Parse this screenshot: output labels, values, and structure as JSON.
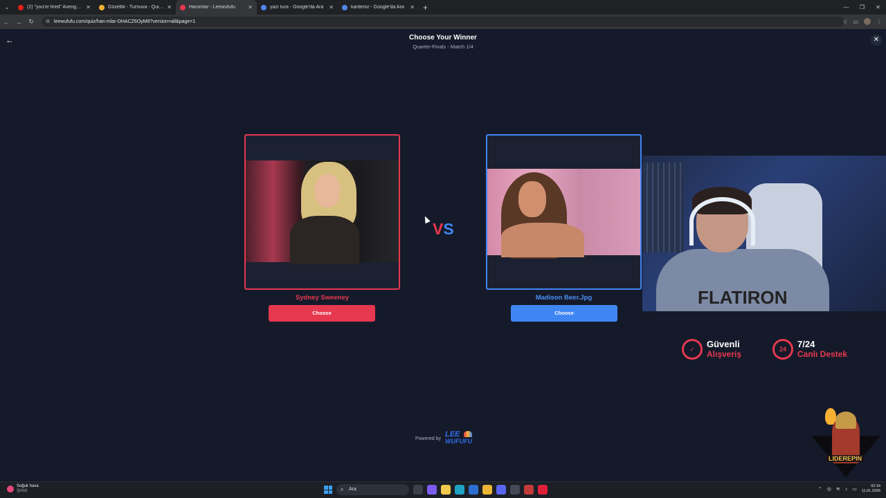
{
  "browser": {
    "tabs": [
      {
        "title": "(2) \"you're fired\" Avengers natu",
        "favicon_color": "#e62117",
        "active": false
      },
      {
        "title": "Güzellik - Turnuva - Quizei",
        "favicon_color": "#f2b134",
        "active": false
      },
      {
        "title": "Hanımlar - Leewufufu",
        "favicon_color": "#e6384f",
        "active": true
      },
      {
        "title": "yazı tura - Google'da Ara",
        "favicon_color": "#4f86ec",
        "active": false
      },
      {
        "title": "kardeniz - Google'da Ara",
        "favicon_color": "#4f86ec",
        "active": false
      }
    ],
    "url": "leewufufu.com/quiz/han-mlar-DHACZ6OyM8?version=all&page=1"
  },
  "page": {
    "title": "Choose Your Winner",
    "subtitle": "Quarter-Finals - Match 1/4",
    "vs_v": "V",
    "vs_s": "S",
    "left": {
      "name": "Sydney Sweeney",
      "button": "Choose",
      "color": "#e6384f"
    },
    "right": {
      "name": "Madison Beer.Jpg",
      "button": "Choose",
      "color": "#3f86f3"
    },
    "powered_by": "Powered by",
    "logo_top": "LEE",
    "logo_bottom": "WUFUFU"
  },
  "stream_overlay": {
    "sweater_text": "FLATIRON",
    "promo_secure_1": "Güvenli",
    "promo_secure_2": "Alışveriş",
    "promo_support_1": "7/24",
    "promo_support_2": "Canlı Destek",
    "badge": "LIDEREPIN"
  },
  "taskbar": {
    "weather_title": "Soğuk hava",
    "weather_sub": "Şimdi",
    "search_placeholder": "Ara",
    "time": "02:16",
    "date": "11.01.2026"
  }
}
